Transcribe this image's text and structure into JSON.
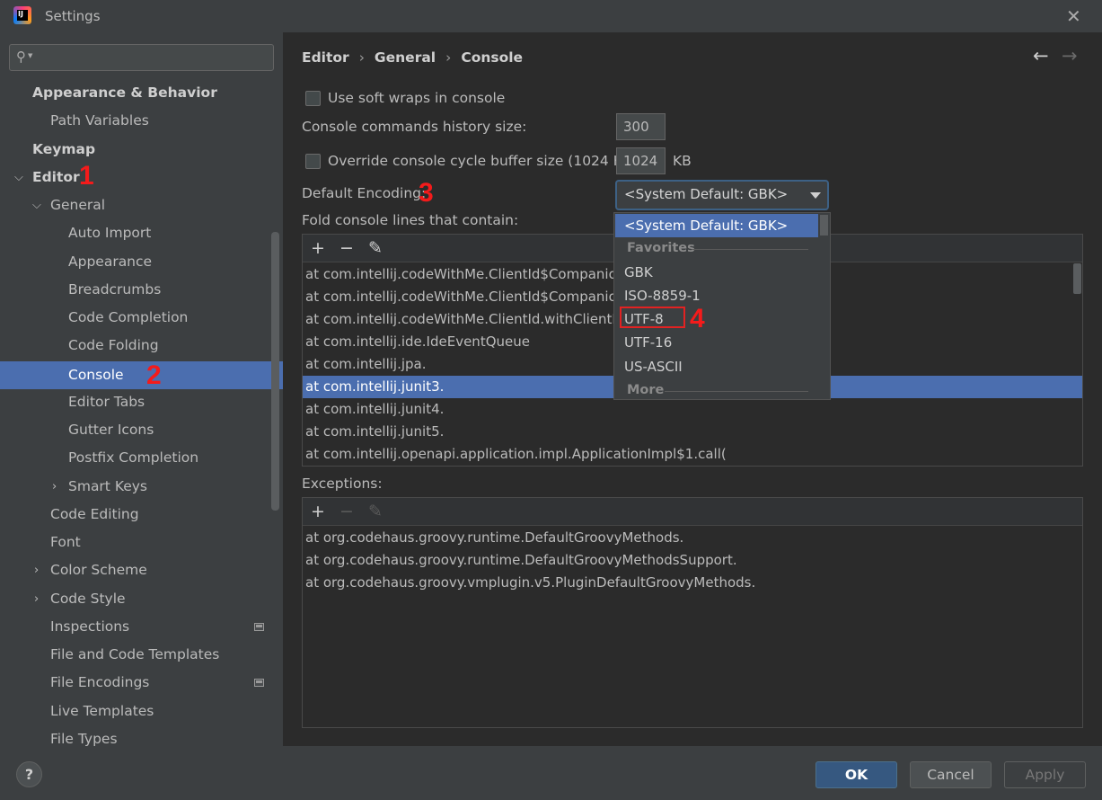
{
  "window": {
    "title": "Settings",
    "app_icon_text": "IJ"
  },
  "search": {
    "placeholder": ""
  },
  "sidebar": {
    "items": [
      {
        "label": "Appearance & Behavior",
        "bold": true,
        "chevron": "",
        "badge": false
      },
      {
        "label": "Path Variables",
        "bold": false,
        "chevron": "",
        "badge": false
      },
      {
        "label": "Keymap",
        "bold": true,
        "chevron": "",
        "badge": false
      },
      {
        "label": "Editor",
        "bold": true,
        "chevron": "expanded",
        "badge": false
      },
      {
        "label": "General",
        "bold": false,
        "chevron": "expanded",
        "badge": false
      },
      {
        "label": "Auto Import",
        "bold": false,
        "chevron": "",
        "badge": false
      },
      {
        "label": "Appearance",
        "bold": false,
        "chevron": "",
        "badge": false
      },
      {
        "label": "Breadcrumbs",
        "bold": false,
        "chevron": "",
        "badge": false
      },
      {
        "label": "Code Completion",
        "bold": false,
        "chevron": "",
        "badge": false
      },
      {
        "label": "Code Folding",
        "bold": false,
        "chevron": "",
        "badge": false
      },
      {
        "label": "Console",
        "bold": false,
        "chevron": "",
        "badge": false,
        "selected": true
      },
      {
        "label": "Editor Tabs",
        "bold": false,
        "chevron": "",
        "badge": false
      },
      {
        "label": "Gutter Icons",
        "bold": false,
        "chevron": "",
        "badge": false
      },
      {
        "label": "Postfix Completion",
        "bold": false,
        "chevron": "",
        "badge": false
      },
      {
        "label": "Smart Keys",
        "bold": false,
        "chevron": "collapsed",
        "badge": false
      },
      {
        "label": "Code Editing",
        "bold": false,
        "chevron": "",
        "badge": false
      },
      {
        "label": "Font",
        "bold": false,
        "chevron": "",
        "badge": false
      },
      {
        "label": "Color Scheme",
        "bold": false,
        "chevron": "collapsed",
        "badge": false
      },
      {
        "label": "Code Style",
        "bold": false,
        "chevron": "collapsed",
        "badge": false
      },
      {
        "label": "Inspections",
        "bold": false,
        "chevron": "",
        "badge": true
      },
      {
        "label": "File and Code Templates",
        "bold": false,
        "chevron": "",
        "badge": false
      },
      {
        "label": "File Encodings",
        "bold": false,
        "chevron": "",
        "badge": true
      },
      {
        "label": "Live Templates",
        "bold": false,
        "chevron": "",
        "badge": false
      },
      {
        "label": "File Types",
        "bold": false,
        "chevron": "",
        "badge": false
      }
    ]
  },
  "annotations": {
    "a1": "1",
    "a2": "2",
    "a3": "3",
    "a4": "4"
  },
  "breadcrumb": {
    "c1": "Editor",
    "c2": "General",
    "c3": "Console",
    "sep": "›"
  },
  "nav": {
    "back": "←",
    "forward": "→"
  },
  "console": {
    "soft_wraps_label": "Use soft wraps in console",
    "history_label": "Console commands history size:",
    "history_value": "300",
    "override_label": "Override console cycle buffer size (1024 KB)",
    "buffer_value": "1024",
    "buffer_unit": "KB",
    "encoding_label": "Default Encoding:",
    "encoding_value": "<System Default: GBK>",
    "fold_label": "Fold console lines that contain:",
    "exceptions_label": "Exceptions:"
  },
  "toolbar": {
    "add": "+",
    "remove": "−",
    "edit": "✎"
  },
  "fold_lines": [
    "at com.intellij.codeWithMe.ClientId$Companion",
    "at com.intellij.codeWithMe.ClientId$Companion",
    "at com.intellij.codeWithMe.ClientId.withClientId",
    "at com.intellij.ide.IdeEventQueue",
    "at com.intellij.jpa.",
    "at com.intellij.junit3.",
    "at com.intellij.junit4.",
    "at com.intellij.junit5.",
    "at com.intellij.openapi.application.impl.ApplicationImpl$1.call("
  ],
  "exceptions": [
    "at org.codehaus.groovy.runtime.DefaultGroovyMethods.",
    "at org.codehaus.groovy.runtime.DefaultGroovyMethodsSupport.",
    "at org.codehaus.groovy.vmplugin.v5.PluginDefaultGroovyMethods."
  ],
  "encoding_dropdown": {
    "selected": "<System Default: GBK>",
    "group_favorites": "Favorites",
    "favorites": [
      "GBK",
      "ISO-8859-1",
      "UTF-8",
      "UTF-16",
      "US-ASCII"
    ],
    "group_more": "More"
  },
  "footer": {
    "help": "?",
    "ok": "OK",
    "cancel": "Cancel",
    "apply": "Apply"
  },
  "colors": {
    "selection": "#4b6eaf",
    "annotation": "#f41b1b",
    "background": "#2b2b2b",
    "panel": "#3c3f41"
  }
}
